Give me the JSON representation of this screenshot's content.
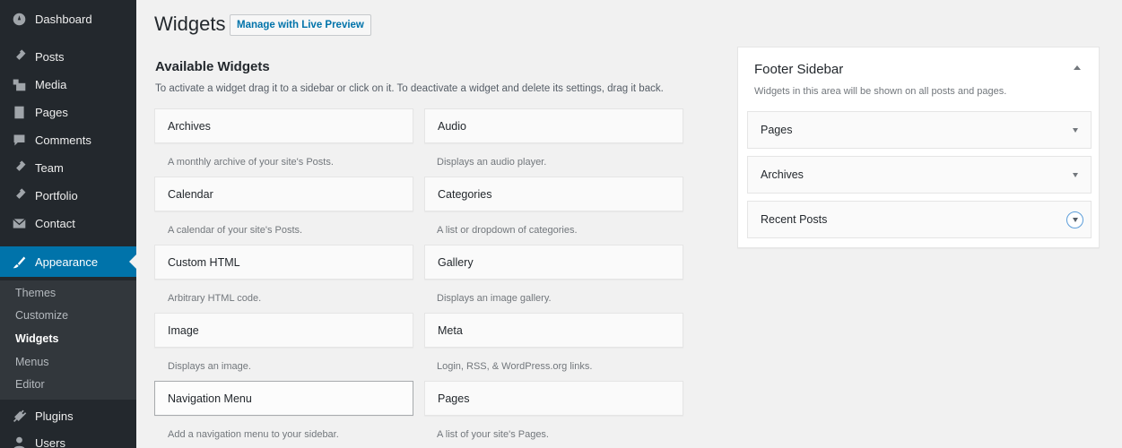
{
  "admin_menu": {
    "items": [
      {
        "label": "Dashboard",
        "icon": "dashboard-icon"
      },
      {
        "label": "Posts",
        "icon": "pin-icon"
      },
      {
        "label": "Media",
        "icon": "media-icon"
      },
      {
        "label": "Pages",
        "icon": "page-icon"
      },
      {
        "label": "Comments",
        "icon": "comment-icon"
      },
      {
        "label": "Team",
        "icon": "pin-icon"
      },
      {
        "label": "Portfolio",
        "icon": "pin-icon"
      },
      {
        "label": "Contact",
        "icon": "mail-icon"
      },
      {
        "label": "Appearance",
        "icon": "brush-icon",
        "current": true
      },
      {
        "label": "Plugins",
        "icon": "plug-icon"
      },
      {
        "label": "Users",
        "icon": "user-icon"
      }
    ],
    "submenu": [
      {
        "label": "Themes"
      },
      {
        "label": "Customize"
      },
      {
        "label": "Widgets",
        "current": true
      },
      {
        "label": "Menus"
      },
      {
        "label": "Editor"
      }
    ]
  },
  "header": {
    "title": "Widgets",
    "action_label": "Manage with Live Preview"
  },
  "available": {
    "title": "Available Widgets",
    "description": "To activate a widget drag it to a sidebar or click on it. To deactivate a widget and delete its settings, drag it back.",
    "widgets": [
      {
        "name": "Archives",
        "description": "A monthly archive of your site's Posts."
      },
      {
        "name": "Audio",
        "description": "Displays an audio player."
      },
      {
        "name": "Calendar",
        "description": "A calendar of your site's Posts."
      },
      {
        "name": "Categories",
        "description": "A list or dropdown of categories."
      },
      {
        "name": "Custom HTML",
        "description": "Arbitrary HTML code."
      },
      {
        "name": "Gallery",
        "description": "Displays an image gallery."
      },
      {
        "name": "Image",
        "description": "Displays an image."
      },
      {
        "name": "Meta",
        "description": "Login, RSS, & WordPress.org links."
      },
      {
        "name": "Navigation Menu",
        "description": "Add a navigation menu to your sidebar."
      },
      {
        "name": "Pages",
        "description": "A list of your site's Pages."
      }
    ]
  },
  "footer_sidebar": {
    "title": "Footer Sidebar",
    "description": "Widgets in this area will be shown on all posts and pages.",
    "widgets": [
      {
        "name": "Pages"
      },
      {
        "name": "Archives"
      },
      {
        "name": "Recent Posts"
      }
    ]
  },
  "colors": {
    "menu_bg": "#23282d",
    "accent": "#0073aa",
    "page_bg": "#f1f1f1"
  }
}
